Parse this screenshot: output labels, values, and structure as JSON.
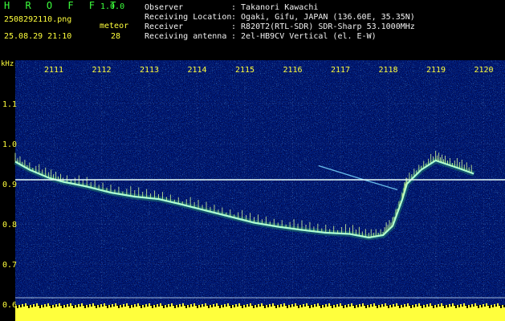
{
  "app": {
    "logo": "H R O F F T",
    "version": "1.0.0",
    "filename": "2508292110.png",
    "datetime": "25.08.29 21:10",
    "meteor_label": "meteor",
    "meteor_count": "28"
  },
  "info": [
    {
      "key": "Observer",
      "value": ": Takanori Kawachi"
    },
    {
      "key": "Receiving Location",
      "value": ": Ogaki, Gifu, JAPAN (136.60E, 35.35N)"
    },
    {
      "key": "Receiver",
      "value": ": R820T2(RTL-SDR) SDR-Sharp 53.1000MHz"
    },
    {
      "key": "Receiving antenna",
      "value": ": 2el-HB9CV Vertical (el. E-W)"
    }
  ],
  "axis": {
    "unit": "kHz",
    "y_ticks": [
      "1.1",
      "1.0",
      "0.9",
      "0.8",
      "0.7",
      "0.6"
    ],
    "x_ticks": [
      "2111",
      "2112",
      "2113",
      "2114",
      "2115",
      "2116",
      "2117",
      "2118",
      "2119",
      "2120"
    ]
  },
  "colors": {
    "background": "#00003c",
    "label_yellow": "#ffff3c",
    "label_green": "#3cff3c",
    "carrier": "#e8fff8",
    "signal": "#a8ffd8"
  },
  "chart_data": {
    "type": "heatmap",
    "xlabel": "",
    "ylabel": "kHz",
    "x_ticks": [
      "2111",
      "2112",
      "2113",
      "2114",
      "2115",
      "2116",
      "2117",
      "2118",
      "2119",
      "2120"
    ],
    "y_ticks": [
      1.1,
      1.0,
      0.9,
      0.8,
      0.7,
      0.6
    ],
    "ylim": [
      0.58,
      1.2
    ],
    "carrier_line_khz": 0.91,
    "trace": [
      {
        "t": 0.0,
        "f": 0.955
      },
      {
        "t": 0.3,
        "f": 0.935
      },
      {
        "t": 0.7,
        "f": 0.915
      },
      {
        "t": 1.0,
        "f": 0.905
      },
      {
        "t": 1.5,
        "f": 0.893
      },
      {
        "t": 2.0,
        "f": 0.878
      },
      {
        "t": 2.5,
        "f": 0.868
      },
      {
        "t": 3.0,
        "f": 0.862
      },
      {
        "t": 3.5,
        "f": 0.848
      },
      {
        "t": 4.0,
        "f": 0.833
      },
      {
        "t": 4.5,
        "f": 0.818
      },
      {
        "t": 5.0,
        "f": 0.803
      },
      {
        "t": 5.5,
        "f": 0.793
      },
      {
        "t": 6.0,
        "f": 0.785
      },
      {
        "t": 6.5,
        "f": 0.778
      },
      {
        "t": 7.0,
        "f": 0.775
      },
      {
        "t": 7.4,
        "f": 0.766
      },
      {
        "t": 7.7,
        "f": 0.772
      },
      {
        "t": 7.9,
        "f": 0.795
      },
      {
        "t": 8.1,
        "f": 0.86
      },
      {
        "t": 8.2,
        "f": 0.9
      },
      {
        "t": 8.5,
        "f": 0.935
      },
      {
        "t": 8.8,
        "f": 0.958
      },
      {
        "t": 9.0,
        "f": 0.95
      },
      {
        "t": 9.3,
        "f": 0.938
      },
      {
        "t": 9.6,
        "f": 0.925
      }
    ],
    "oblique_trace": [
      {
        "t": 6.35,
        "f": 0.945
      },
      {
        "t": 7.3,
        "f": 0.91
      },
      {
        "t": 8.0,
        "f": 0.885
      }
    ]
  }
}
